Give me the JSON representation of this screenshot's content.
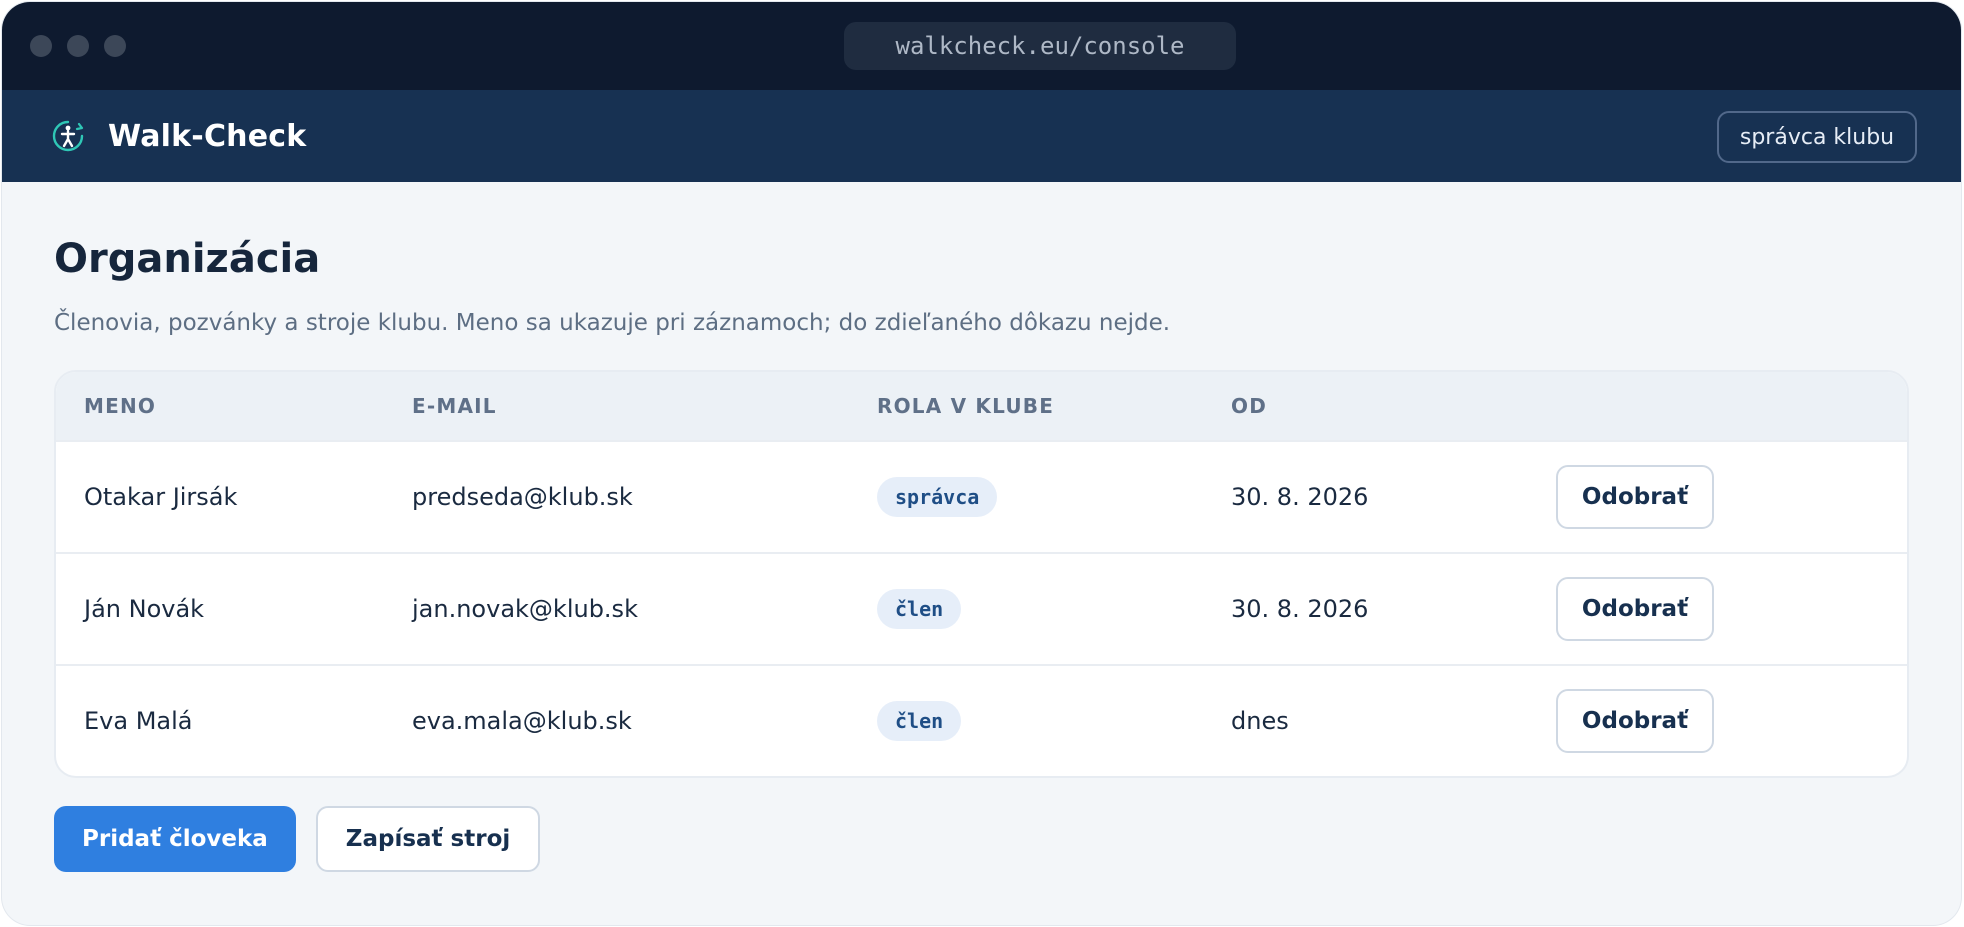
{
  "browser": {
    "url": "walkcheck.eu/console"
  },
  "app": {
    "name": "Walk-Check",
    "logo_icon": "walker-clock-icon",
    "role_label": "správca klubu",
    "colors": {
      "header": "#173152",
      "accent": "#2f7fe0",
      "logo": "#2fc7b6"
    }
  },
  "page": {
    "title": "Organizácia",
    "subtitle": "Členovia, pozvánky a stroje klubu. Meno sa ukazuje pri záznamoch; do zdieľaného dôkazu nejde."
  },
  "table": {
    "headers": {
      "name": "MENO",
      "email": "E-MAIL",
      "role": "ROLA V KLUBE",
      "since": "OD"
    },
    "rows": [
      {
        "name": "Otakar Jirsák",
        "email": "predseda@klub.sk",
        "role": "správca",
        "since": "30. 8. 2026",
        "action": "Odobrať"
      },
      {
        "name": "Ján Novák",
        "email": "jan.novak@klub.sk",
        "role": "člen",
        "since": "30. 8. 2026",
        "action": "Odobrať"
      },
      {
        "name": "Eva Malá",
        "email": "eva.mala@klub.sk",
        "role": "člen",
        "since": "dnes",
        "action": "Odobrať"
      }
    ]
  },
  "actions": {
    "add_person": "Pridať človeka",
    "register_machine": "Zapísať stroj"
  }
}
